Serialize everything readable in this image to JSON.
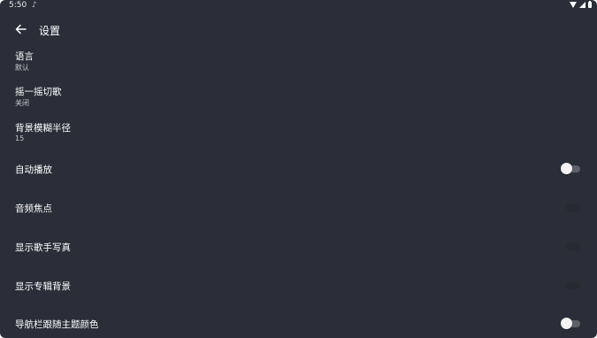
{
  "status_bar": {
    "time": "5:50",
    "notification_icon": "music-note-icon",
    "icons": [
      "wifi-icon",
      "signal-icon",
      "battery-icon"
    ]
  },
  "toolbar": {
    "back_icon": "arrow-left-icon",
    "title": "设置"
  },
  "settings": {
    "language": {
      "title": "语言",
      "summary": "默认"
    },
    "shake_switch": {
      "title": "摇一摇切歌",
      "summary": "关闭"
    },
    "blur_radius": {
      "title": "背景模糊半径",
      "summary": "15"
    },
    "autoplay": {
      "title": "自动播放",
      "checked": false
    },
    "audio_focus": {
      "title": "音频焦点",
      "checked": false
    },
    "show_artist_photo": {
      "title": "显示歌手写真",
      "checked": false
    },
    "show_album_background": {
      "title": "显示专辑背景",
      "checked": false
    },
    "navbar_follow_theme": {
      "title": "导航栏跟随主题颜色",
      "checked": false
    }
  },
  "colors": {
    "background": "#292e38",
    "text_primary": "#ffffff",
    "text_secondary": "#c9ccd1",
    "switch_thumb": "#f4f4f4",
    "switch_track": "#5d6168"
  }
}
